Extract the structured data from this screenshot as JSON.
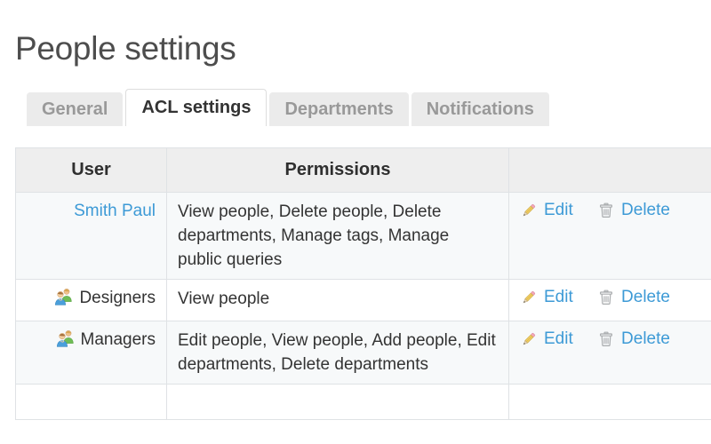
{
  "page": {
    "title": "People settings"
  },
  "tabs": [
    {
      "label": "General",
      "active": false,
      "name": "tab-general"
    },
    {
      "label": "ACL settings",
      "active": true,
      "name": "tab-acl-settings"
    },
    {
      "label": "Departments",
      "active": false,
      "name": "tab-departments"
    },
    {
      "label": "Notifications",
      "active": false,
      "name": "tab-notifications"
    }
  ],
  "table": {
    "columns": [
      "User",
      "Permissions",
      ""
    ],
    "actions": {
      "edit_label": "Edit",
      "delete_label": "Delete",
      "edit_icon": "pencil-icon",
      "delete_icon": "trash-icon"
    },
    "rows": [
      {
        "user": "Smith Paul",
        "is_group": false,
        "icon": "",
        "permissions": "View people, Delete people, Delete departments, Manage tags, Manage public queries"
      },
      {
        "user": "Designers",
        "is_group": true,
        "icon": "group-icon",
        "permissions": "View people"
      },
      {
        "user": "Managers",
        "is_group": true,
        "icon": "group-icon",
        "permissions": "Edit people, View people, Add people, Edit departments, Delete departments"
      },
      {
        "user": "",
        "is_group": false,
        "icon": "",
        "permissions": ""
      }
    ]
  },
  "colors": {
    "link": "#3d9ad6",
    "title_text": "#4d4d4d",
    "tab_inactive_bg": "#ebebeb",
    "tab_inactive_text": "#999999",
    "tab_active_bg": "#ffffff",
    "tab_active_text": "#333333",
    "table_header_bg": "#eeeeee",
    "row_odd_bg": "#f7f9fa",
    "row_even_bg": "#ffffff",
    "border": "#dfe2e5"
  }
}
